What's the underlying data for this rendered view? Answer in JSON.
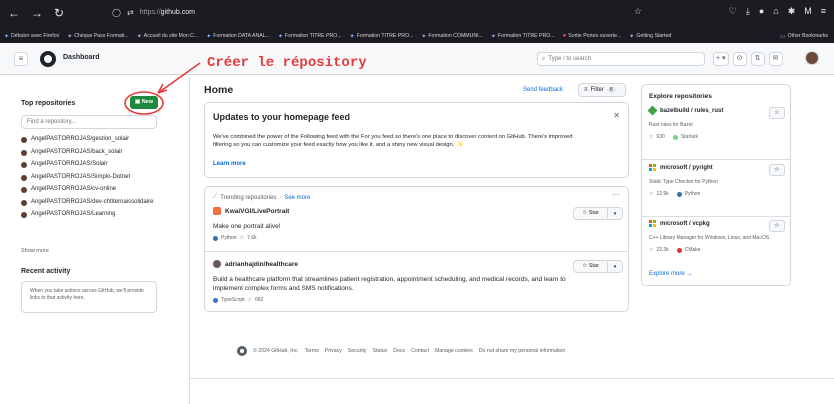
{
  "browser": {
    "url_prefix": "https://",
    "url_host": "github.com",
    "bookmarks": [
      "Débuter avec Firefox",
      "Chèque Pass Formati...",
      "Accueil du site Mon C...",
      "Formation DATA ANAL...",
      "Formation TITRE PRO...",
      "Formation TITRE PRO...",
      "Formation COMMUNI...",
      "Formation TITRE PRO...",
      "Sortie Portes ouverte...",
      "Getting Started"
    ],
    "other_bookmarks": "Other Bookmarks"
  },
  "header": {
    "title": "Dashboard",
    "search_placeholder": "Type / to search"
  },
  "annotation": {
    "text": "Créer le répository",
    "color": "#e43c3c"
  },
  "sidebar": {
    "top_repos_title": "Top repositories",
    "new_label": "New",
    "find_placeholder": "Find a repository...",
    "repos": [
      "AngelPASTORROJAS/gestion_solair",
      "AngelPASTORROJAS/back_solair",
      "AngelPASTORROJAS/Solair",
      "AngelPASTORROJAS/Simplo-Dotnet",
      "AngelPASTORROJAS/cv-online",
      "AngelPASTORROJAS/dev-chtiternaissolidaire",
      "AngelPASTORROJAS/Learning"
    ],
    "show_more": "Show more",
    "recent_title": "Recent activity",
    "recent_text": "When you take actions across GitHub, we'll provide links to that activity here."
  },
  "main": {
    "home_title": "Home",
    "send_feedback": "Send feedback",
    "filter_label": "Filter",
    "filter_count": "8",
    "feed": {
      "title": "Updates to your homepage feed",
      "body": "We've combined the power of the Following feed with the For you feed so there's one place to discover content on GitHub. There's improved filtering so you can customize your feed exactly how you like it, and a shiny new visual design. ✨",
      "learn_more": "Learn more"
    },
    "trending": {
      "label": "Trending repositories",
      "see_more": "See more",
      "star_label": "Star",
      "repos": [
        {
          "name": "KwaiVGI/LivePortrait",
          "description": "Make one portrait alive!",
          "language": "Python",
          "lang_color": "#3572A5",
          "stars": "7.6k"
        },
        {
          "name": "adrianhajdin/healthcare",
          "description": "Build a healthcare platform that streamlines patient registration, appointment scheduling, and medical records, and learn to implement complex forms and SMS notifications.",
          "language": "TypeScript",
          "lang_color": "#3178c6",
          "stars": "682"
        }
      ]
    }
  },
  "explore": {
    "title": "Explore repositories",
    "items": [
      {
        "name": "bazelbuild / rules_rust",
        "description": "Rust rules for Bazel",
        "stars": "630",
        "language": "Starlark",
        "lang_color": "#76d275"
      },
      {
        "name": "microsoft / pyright",
        "description": "Static Type Checker for Python",
        "stars": "12.9k",
        "language": "Python",
        "lang_color": "#3572A5"
      },
      {
        "name": "microsoft / vcpkg",
        "description": "C++ Library Manager for Windows, Linux, and MacOS",
        "stars": "22.3k",
        "language": "CMake",
        "lang_color": "#DA3434"
      }
    ],
    "explore_more": "Explore more →"
  },
  "footer": {
    "copyright": "© 2024 GitHub, Inc.",
    "links": [
      "Terms",
      "Privacy",
      "Security",
      "Status",
      "Docs",
      "Contact",
      "Manage cookies",
      "Do not share my personal information"
    ]
  }
}
